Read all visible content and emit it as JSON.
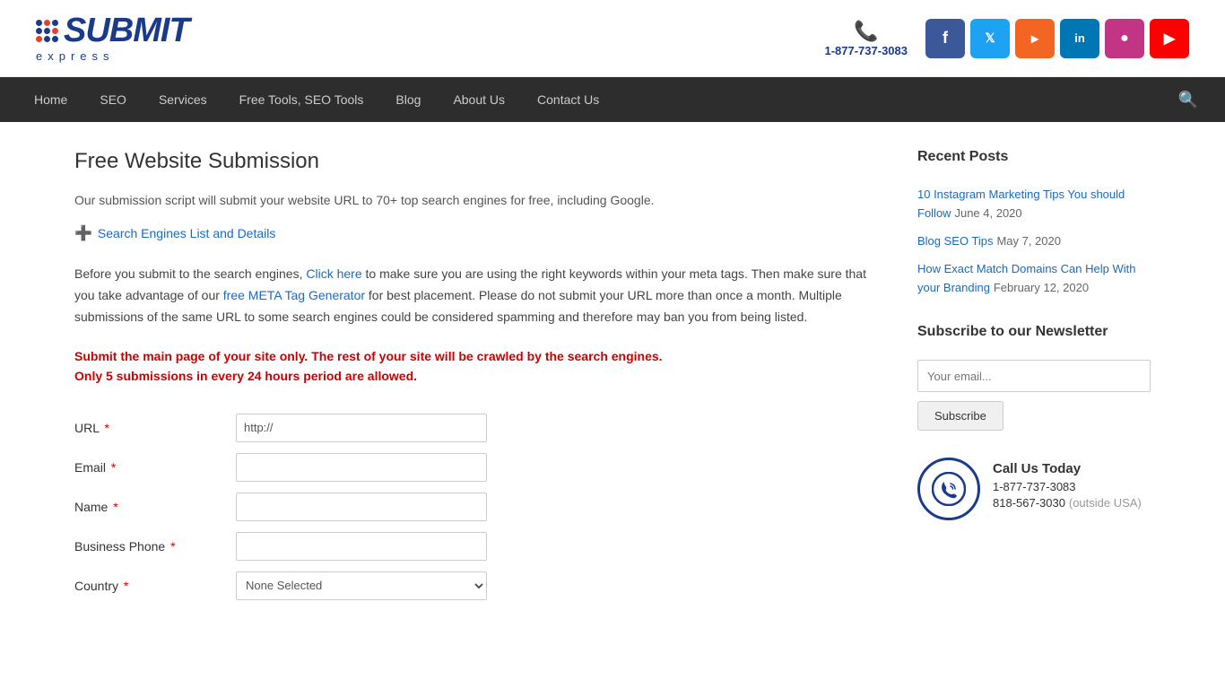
{
  "header": {
    "phone": "1-877-737-3083",
    "logo_name": "SUBMIT",
    "logo_sub": "express"
  },
  "social": [
    {
      "label": "Facebook",
      "class": "social-fb",
      "symbol": "f"
    },
    {
      "label": "Twitter",
      "class": "social-tw",
      "symbol": "t"
    },
    {
      "label": "RSS",
      "class": "social-rss",
      "symbol": "R"
    },
    {
      "label": "LinkedIn",
      "class": "social-li",
      "symbol": "in"
    },
    {
      "label": "Instagram",
      "class": "social-ig",
      "symbol": "📷"
    },
    {
      "label": "YouTube",
      "class": "social-yt",
      "symbol": "▶"
    }
  ],
  "nav": {
    "items": [
      {
        "label": "Home",
        "id": "home"
      },
      {
        "label": "SEO",
        "id": "seo"
      },
      {
        "label": "Services",
        "id": "services"
      },
      {
        "label": "Free Tools, SEO Tools",
        "id": "free-tools"
      },
      {
        "label": "Blog",
        "id": "blog"
      },
      {
        "label": "About Us",
        "id": "about"
      },
      {
        "label": "Contact Us",
        "id": "contact"
      }
    ]
  },
  "main": {
    "page_title": "Free Website Submission",
    "intro": "Our submission script will submit your website URL to 70+ top search engines for free, including Google.",
    "search_engines_link": "Search Engines List and Details",
    "body_text_1": "Before you submit to the search engines,",
    "click_here": "Click here",
    "body_text_2": "to make sure you are using the right keywords within your meta tags. Then make sure that you take advantage of our",
    "meta_tag_link": "free META Tag Generator",
    "body_text_3": "for best placement.  Please do not submit your URL more than once a month. Multiple submissions of the same URL to some search engines could be considered spamming and therefore may ban you from being listed.",
    "warning_line1": "Submit the main page of your site only.  The rest of your site will be crawled by the search engines.",
    "warning_line2": "Only 5 submissions in every 24 hours period are allowed.",
    "form": {
      "url_label": "URL",
      "url_placeholder": "http://",
      "email_label": "Email",
      "name_label": "Name",
      "phone_label": "Business Phone",
      "country_label": "Country",
      "country_default": "None Selected",
      "required_symbol": "*"
    }
  },
  "sidebar": {
    "recent_posts_title": "Recent Posts",
    "posts": [
      {
        "title": "10 Instagram Marketing Tips You should Follow",
        "date": "June 4, 2020"
      },
      {
        "title": "Blog SEO Tips",
        "date": "May 7, 2020"
      },
      {
        "title": "How Exact Match Domains Can Help With your Branding",
        "date": "February 12, 2020"
      }
    ],
    "newsletter_title": "Subscribe to our Newsletter",
    "newsletter_placeholder": "Your email...",
    "subscribe_label": "Subscribe",
    "call_us_title": "Call Us Today",
    "call_us_main": "1-877-737-3083",
    "call_us_outside": "818-567-3030",
    "call_us_note": "(outside USA)"
  }
}
